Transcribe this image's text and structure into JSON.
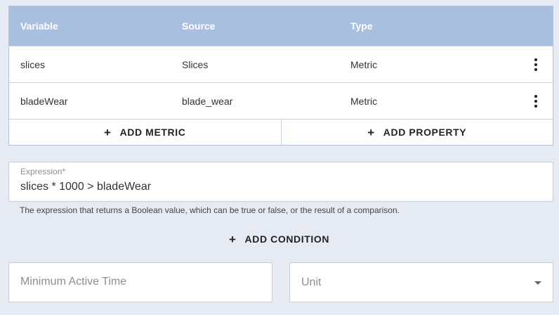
{
  "table": {
    "headers": [
      "Variable",
      "Source",
      "Type"
    ],
    "rows": [
      {
        "variable": "slices",
        "source": "Slices",
        "type": "Metric"
      },
      {
        "variable": "bladeWear",
        "source": "blade_wear",
        "type": "Metric"
      }
    ],
    "row_menu_icon": "more-vert-icon"
  },
  "actions": {
    "add_metric": "ADD METRIC",
    "add_property": "ADD PROPERTY",
    "plus_icon": "+"
  },
  "expression": {
    "label": "Expression*",
    "value": "slices * 1000 > bladeWear",
    "helper": "The expression that returns a Boolean value, which can be true or false, or the result of a comparison."
  },
  "add_condition": "ADD CONDITION",
  "min_active_time": {
    "placeholder": "Minimum Active Time"
  },
  "unit": {
    "placeholder": "Unit"
  },
  "colors": {
    "header_bg": "#a9bfe0",
    "page_bg": "#e6eaf3"
  }
}
